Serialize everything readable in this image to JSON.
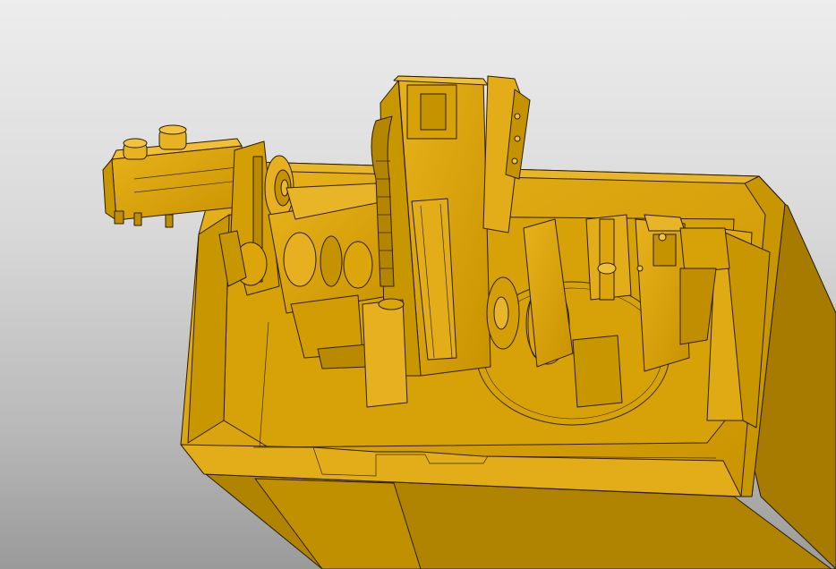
{
  "viewport": {
    "label": "",
    "background_top": "#ededed",
    "background_bottom": "#9a9a9a"
  },
  "model": {
    "material_color": "#d9a306",
    "shadow_color": "#b58700",
    "highlight_color": "#f2c43a",
    "edge_color": "#2a1e00"
  }
}
